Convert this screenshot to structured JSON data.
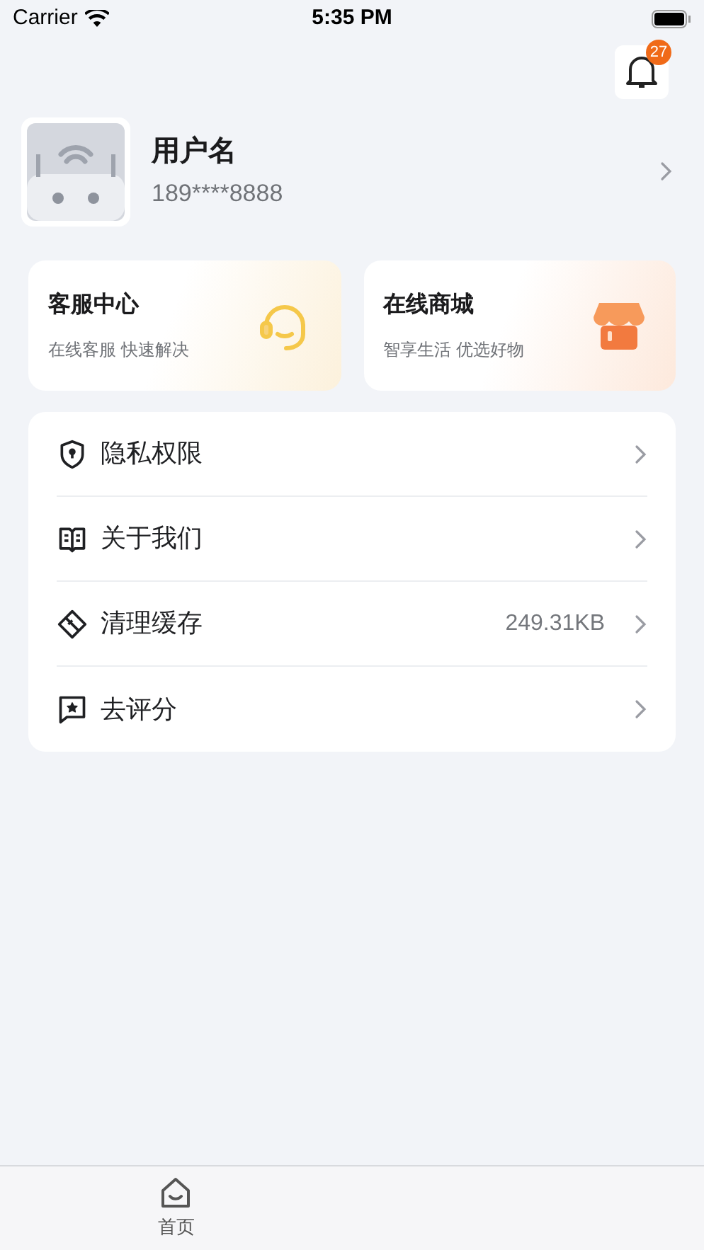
{
  "status_bar": {
    "carrier": "Carrier",
    "time": "5:35 PM"
  },
  "notifications": {
    "badge": "27"
  },
  "profile": {
    "name": "用户名",
    "phone": "189****8888"
  },
  "cards": [
    {
      "kind": "service",
      "title": "客服中心",
      "subtitle": "在线客服 快速解决"
    },
    {
      "kind": "shop",
      "title": "在线商城",
      "subtitle": "智享生活 优选好物"
    }
  ],
  "menu": [
    {
      "kind": "privacy",
      "label": "隐私权限"
    },
    {
      "kind": "about",
      "label": "关于我们"
    },
    {
      "kind": "cache",
      "label": "清理缓存",
      "value": "249.31KB"
    },
    {
      "kind": "rate",
      "label": "去评分"
    }
  ],
  "tab_bar": [
    {
      "label": "首页"
    }
  ]
}
